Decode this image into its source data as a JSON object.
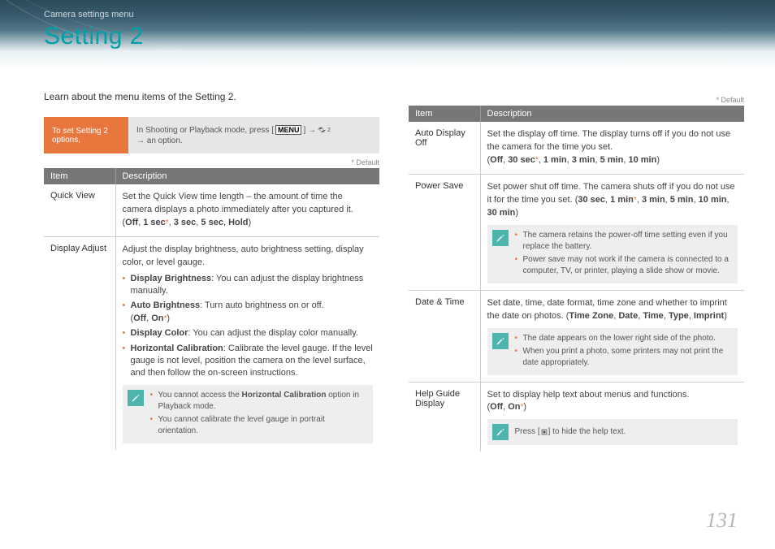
{
  "breadcrumb": "Camera settings menu",
  "title": "Setting 2",
  "intro": "Learn about the menu items of the Setting 2.",
  "instruction_left": "To set Setting 2 options,",
  "instruction_right_pre": "In Shooting or Playback mode, press [",
  "instruction_menu": "MENU",
  "instruction_right_post": "] → ",
  "instruction_trail": " → an option.",
  "default_note": "* Default",
  "table_headers": {
    "item": "Item",
    "desc": "Description"
  },
  "left_rows": {
    "quick_view": {
      "name": "Quick View",
      "desc": "Set the Quick View time length – the amount of time the camera displays a photo immediately after you captured it.",
      "opts_pre": "(",
      "opts": "Off, 1 sec*, 3 sec, 5 sec, Hold",
      "opts_post": ")"
    },
    "display_adjust": {
      "name": "Display Adjust",
      "desc": "Adjust the display brightness, auto brightness setting, display color, or level gauge.",
      "b1_label": "Display Brightness",
      "b1_text": ": You can adjust the display brightness manually.",
      "b2_label": "Auto Brightness",
      "b2_text": ": Turn auto brightness on or off.",
      "b2_opts": "(Off, On*)",
      "b3_label": "Display Color",
      "b3_text": ": You can adjust the display color manually.",
      "b4_label": "Horizontal Calibration",
      "b4_text": ": Calibrate the level gauge. If the level gauge is not level, position the camera on the level surface, and then follow the on-screen instructions.",
      "note1_pre": "You cannot access the ",
      "note1_bold": "Horizontal Calibration",
      "note1_post": " option in Playback mode.",
      "note2": "You cannot calibrate the level gauge in portrait orientation."
    }
  },
  "right_rows": {
    "auto_display": {
      "name": "Auto Display Off",
      "desc": "Set the display off time. The display turns off if you do not use the camera for the time you set.",
      "opts": "(Off, 30 sec*, 1 min, 3 min, 5 min, 10 min)"
    },
    "power_save": {
      "name": "Power Save",
      "desc": "Set power shut off time. The camera shuts off if you do not use it for the time you set. ",
      "opts": "(30 sec, 1 min*, 3 min, 5 min, 10 min, 30 min)",
      "note1": "The camera retains the power-off time setting even if you replace the battery.",
      "note2": "Power save may not work if the camera is connected to a computer, TV, or printer, playing a slide show or movie."
    },
    "date_time": {
      "name": "Date & Time",
      "desc_pre": "Set date, time, date format, time zone and whether to imprint the date on photos. (",
      "opts": "Time Zone, Date, Time, Type, Imprint",
      "desc_post": ")",
      "note1": "The date appears on the lower right side of the photo.",
      "note2": "When you print a photo, some printers may not print the date appropriately."
    },
    "help_guide": {
      "name": "Help Guide Display",
      "desc": "Set to display help text about menus and functions.",
      "opts": "(Off, On*)",
      "note_pre": "Press [",
      "note_post": "] to hide the help text."
    }
  },
  "page_number": "131"
}
